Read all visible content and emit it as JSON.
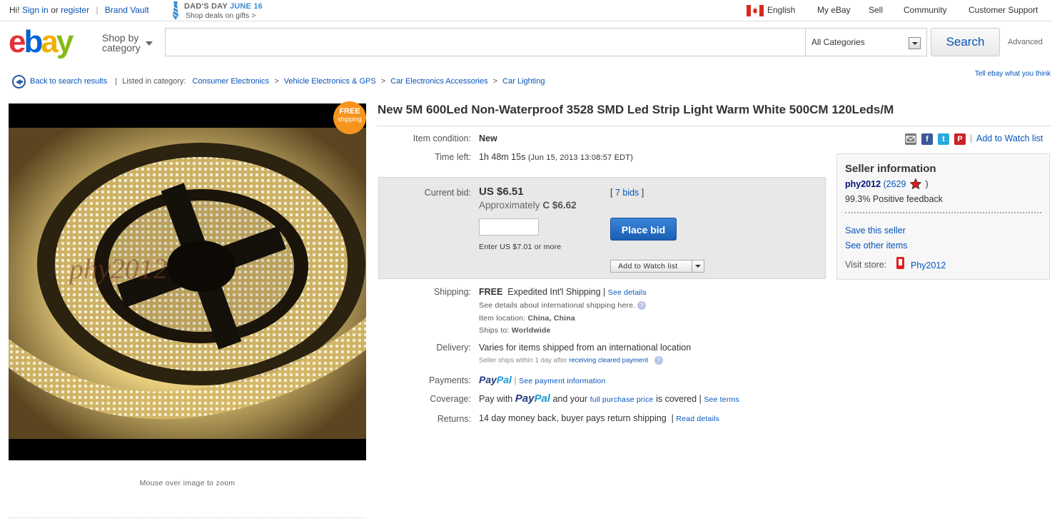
{
  "topbar": {
    "greeting": "Hi!",
    "sign_in": "Sign in",
    "or": "or",
    "register": "register",
    "brand_vault": "Brand Vault",
    "promo_line1": "DAD'S DAY",
    "promo_date": "JUNE 16",
    "promo_line2": "Shop deals on gifts >",
    "language": "English",
    "my_ebay": "My eBay",
    "sell": "Sell",
    "community": "Community",
    "customer_support": "Customer Support"
  },
  "header": {
    "shop_by_line1": "Shop by",
    "shop_by_line2": "category",
    "search_placeholder": "",
    "category_selected": "All Categories",
    "search_button": "Search",
    "advanced": "Advanced",
    "tell_ebay": "Tell ebay what you think"
  },
  "breadcrumb": {
    "back": "Back to search results",
    "listed_in": "Listed in category:",
    "items": [
      "Consumer Electronics",
      "Vehicle Electronics & GPS",
      "Car Electronics Accessories",
      "Car Lighting"
    ]
  },
  "image": {
    "free_badge_1": "FREE",
    "free_badge_2": "shipping",
    "watermark": "phy2012",
    "zoom_note": "Mouse over image to zoom"
  },
  "item": {
    "title": "New 5M 600Led Non-Waterproof 3528 SMD Led Strip Light Warm White 500CM 120Leds/M",
    "condition_label": "Item condition:",
    "condition": "New",
    "time_left_label": "Time left:",
    "time_left": "1h 48m 15s",
    "time_end": "(Jun 15, 2013  13:08:57 EDT)",
    "add_to_watch": "Add to Watch list"
  },
  "bid": {
    "current_bid_label": "Current bid:",
    "current_bid": "US $6.51",
    "approx_prefix": "Approximately",
    "approx_value": "C $6.62",
    "bids": "7 bids",
    "bid_input_value": "",
    "enter_note": "Enter US $7.01 or more",
    "place_bid": "Place bid",
    "add_to_watch": "Add to Watch list"
  },
  "shipping": {
    "label": "Shipping:",
    "free": "FREE",
    "method": "Expedited Int'l Shipping |",
    "see_details": "See details",
    "intl_note": "See details about international shipping here.",
    "location_label": "Item location:",
    "location": "China, China",
    "ships_to_label": "Ships to:",
    "ships_to": "Worldwide"
  },
  "delivery": {
    "label": "Delivery:",
    "text": "Varies for items shipped from an international location",
    "note_prefix": "Seller ships within 1 day after",
    "note_link": "receiving cleared payment"
  },
  "payments": {
    "label": "Payments:",
    "paypal_a": "Pay",
    "paypal_b": "Pal",
    "sep": "|",
    "link": "See payment information"
  },
  "coverage": {
    "label": "Coverage:",
    "pay_with": "Pay with",
    "and_your": "and your",
    "full_price": "full purchase price",
    "is_covered": "is covered |",
    "see_terms": "See terms"
  },
  "returns": {
    "label": "Returns:",
    "text": "14 day money back, buyer pays return shipping",
    "sep": "|",
    "read_details": "Read details"
  },
  "seller": {
    "heading": "Seller information",
    "name": "phy2012",
    "score_open": "(2629",
    "score_close": ")",
    "feedback": "99.3% Positive feedback",
    "save": "Save this seller",
    "other": "See other items",
    "visit_store": "Visit store:",
    "store": "Phy2012"
  },
  "colors": {
    "link": "#0654ba",
    "badge": "#f7941d",
    "place_bid": "#1a5fb4"
  }
}
